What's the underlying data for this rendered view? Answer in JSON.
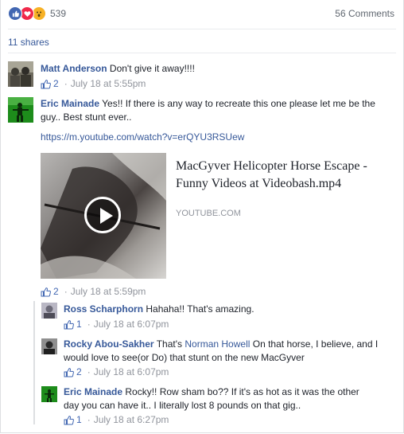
{
  "reactions": {
    "count": "539",
    "icons": [
      "like-icon",
      "love-icon",
      "wow-icon"
    ],
    "colors": {
      "like": "#4267b2",
      "love": "#f0284a",
      "wow": "#f7b125"
    }
  },
  "comments_count": "56 Comments",
  "shares": "11 shares",
  "comments": [
    {
      "author": "Matt Anderson",
      "text": "Don't give it away!!!!",
      "likes": "2",
      "time": "July 18 at 5:55pm"
    },
    {
      "author": "Eric Mainade",
      "text": "Yes!! If there is any way to recreate this one please let me be the guy.. Best stunt ever..",
      "link": "https://m.youtube.com/watch?v=erQYU3RSUew",
      "card": {
        "title": "MacGyver Helicopter Horse Escape - Funny Videos at Videobash.mp4",
        "domain": "YOUTUBE.COM"
      },
      "likes": "2",
      "time": "July 18 at 5:59pm"
    }
  ],
  "replies": [
    {
      "author": "Ross Scharphorn",
      "text": "Hahaha!! That's amazing.",
      "likes": "1",
      "time": "July 18 at 6:07pm"
    },
    {
      "author": "Rocky Abou-Sakher",
      "text_prefix": "That's",
      "mention": "Norman Howell",
      "text": "On that horse, I believe, and I would love to see(or Do) that stunt on the new MacGyver",
      "likes": "2",
      "time": "July 18 at 6:07pm"
    },
    {
      "author": "Eric Mainade",
      "text": "Rocky!! Row sham bo?? If it's as hot as it was the other day you can have it.. I literally lost 8 pounds on that gig..",
      "likes": "1",
      "time": "July 18 at 6:27pm"
    }
  ]
}
